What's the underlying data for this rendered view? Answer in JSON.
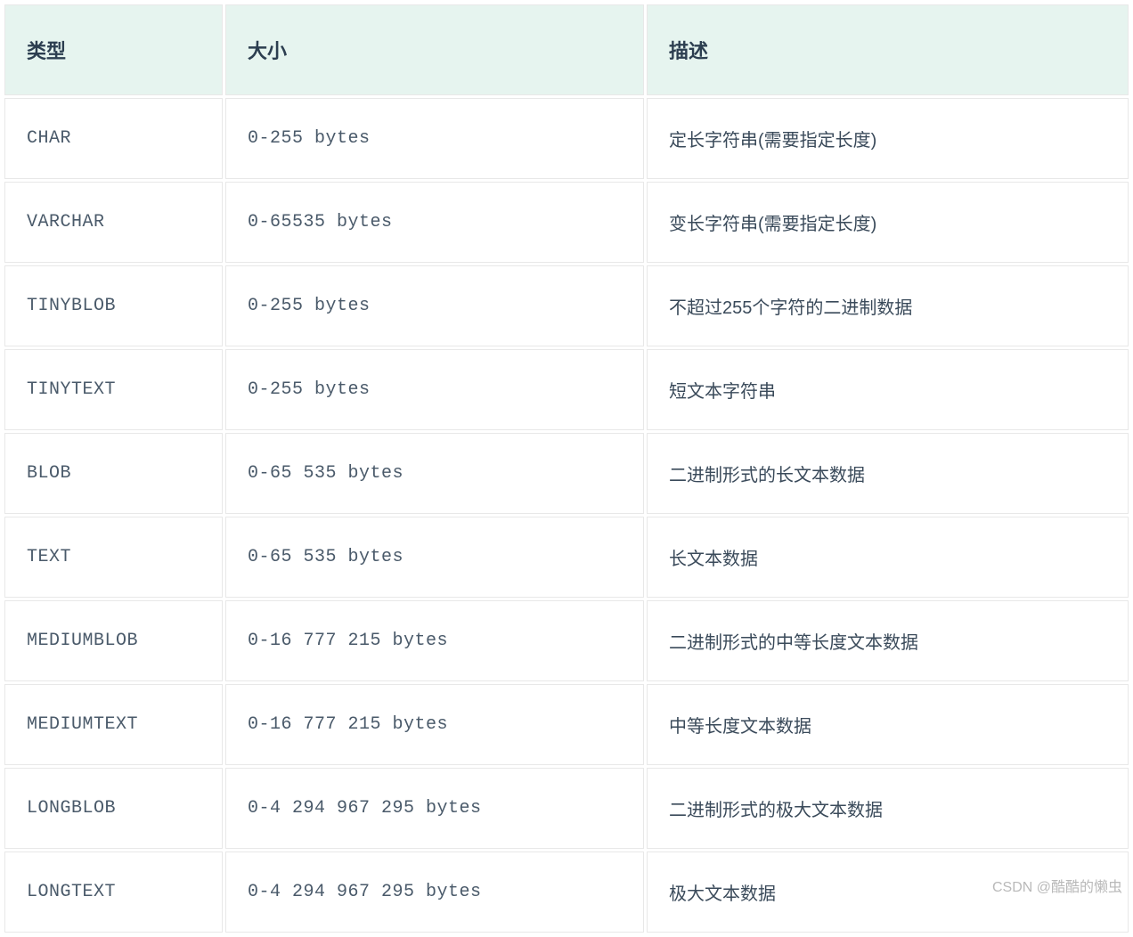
{
  "table": {
    "headers": {
      "type": "类型",
      "size": "大小",
      "description": "描述"
    },
    "rows": [
      {
        "type": "CHAR",
        "size": "0-255 bytes",
        "description": "定长字符串(需要指定长度)"
      },
      {
        "type": "VARCHAR",
        "size": "0-65535 bytes",
        "description": "变长字符串(需要指定长度)"
      },
      {
        "type": "TINYBLOB",
        "size": "0-255 bytes",
        "description": "不超过255个字符的二进制数据"
      },
      {
        "type": "TINYTEXT",
        "size": "0-255 bytes",
        "description": "短文本字符串"
      },
      {
        "type": "BLOB",
        "size": "0-65 535 bytes",
        "description": "二进制形式的长文本数据"
      },
      {
        "type": "TEXT",
        "size": "0-65 535 bytes",
        "description": "长文本数据"
      },
      {
        "type": "MEDIUMBLOB",
        "size": "0-16 777 215 bytes",
        "description": "二进制形式的中等长度文本数据"
      },
      {
        "type": "MEDIUMTEXT",
        "size": "0-16 777 215 bytes",
        "description": "中等长度文本数据"
      },
      {
        "type": "LONGBLOB",
        "size": "0-4 294 967 295 bytes",
        "description": "二进制形式的极大文本数据"
      },
      {
        "type": "LONGTEXT",
        "size": "0-4 294 967 295 bytes",
        "description": "极大文本数据"
      }
    ]
  },
  "watermark": "CSDN @酷酷的懒虫"
}
